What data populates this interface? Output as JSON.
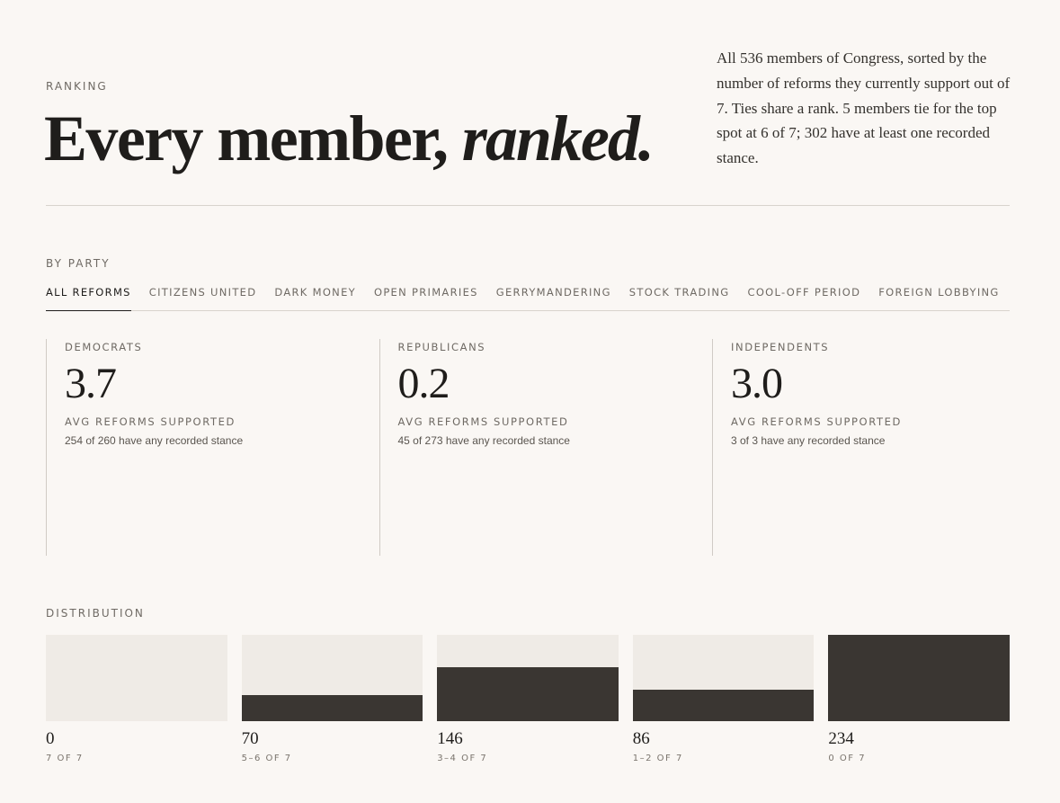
{
  "header": {
    "eyebrow": "RANKING",
    "title_plain": "Every member, ",
    "title_emphasis": "ranked.",
    "intro": "All 536 members of Congress, sorted by the number of reforms they currently support out of 7. Ties share a rank. 5 members tie for the top spot at 6 of 7; 302 have at least one recorded stance."
  },
  "by_party": {
    "eyebrow": "BY PARTY",
    "tabs": [
      {
        "label": "ALL REFORMS",
        "active": true
      },
      {
        "label": "CITIZENS UNITED",
        "active": false
      },
      {
        "label": "DARK MONEY",
        "active": false
      },
      {
        "label": "OPEN PRIMARIES",
        "active": false
      },
      {
        "label": "GERRYMANDERING",
        "active": false
      },
      {
        "label": "STOCK TRADING",
        "active": false
      },
      {
        "label": "COOL-OFF PERIOD",
        "active": false
      },
      {
        "label": "FOREIGN LOBBYING",
        "active": false
      }
    ],
    "parties": [
      {
        "name": "DEMOCRATS",
        "value": "3.7",
        "metric": "AVG REFORMS SUPPORTED",
        "note": "254 of 260 have any recorded stance"
      },
      {
        "name": "REPUBLICANS",
        "value": "0.2",
        "metric": "AVG REFORMS SUPPORTED",
        "note": "45 of 273 have any recorded stance"
      },
      {
        "name": "INDEPENDENTS",
        "value": "3.0",
        "metric": "AVG REFORMS SUPPORTED",
        "note": "3 of 3 have any recorded stance"
      }
    ]
  },
  "distribution": {
    "eyebrow": "DISTRIBUTION",
    "max": 234,
    "buckets": [
      {
        "count": "0",
        "value": 0,
        "range": "7 OF 7"
      },
      {
        "count": "70",
        "value": 70,
        "range": "5–6 OF 7"
      },
      {
        "count": "146",
        "value": 146,
        "range": "3–4 OF 7"
      },
      {
        "count": "86",
        "value": 86,
        "range": "1–2 OF 7"
      },
      {
        "count": "234",
        "value": 234,
        "range": "0 OF 7"
      }
    ]
  },
  "colors": {
    "background": "#faf7f4",
    "bar_fill": "#3a3632",
    "bar_track": "#efebe6"
  }
}
